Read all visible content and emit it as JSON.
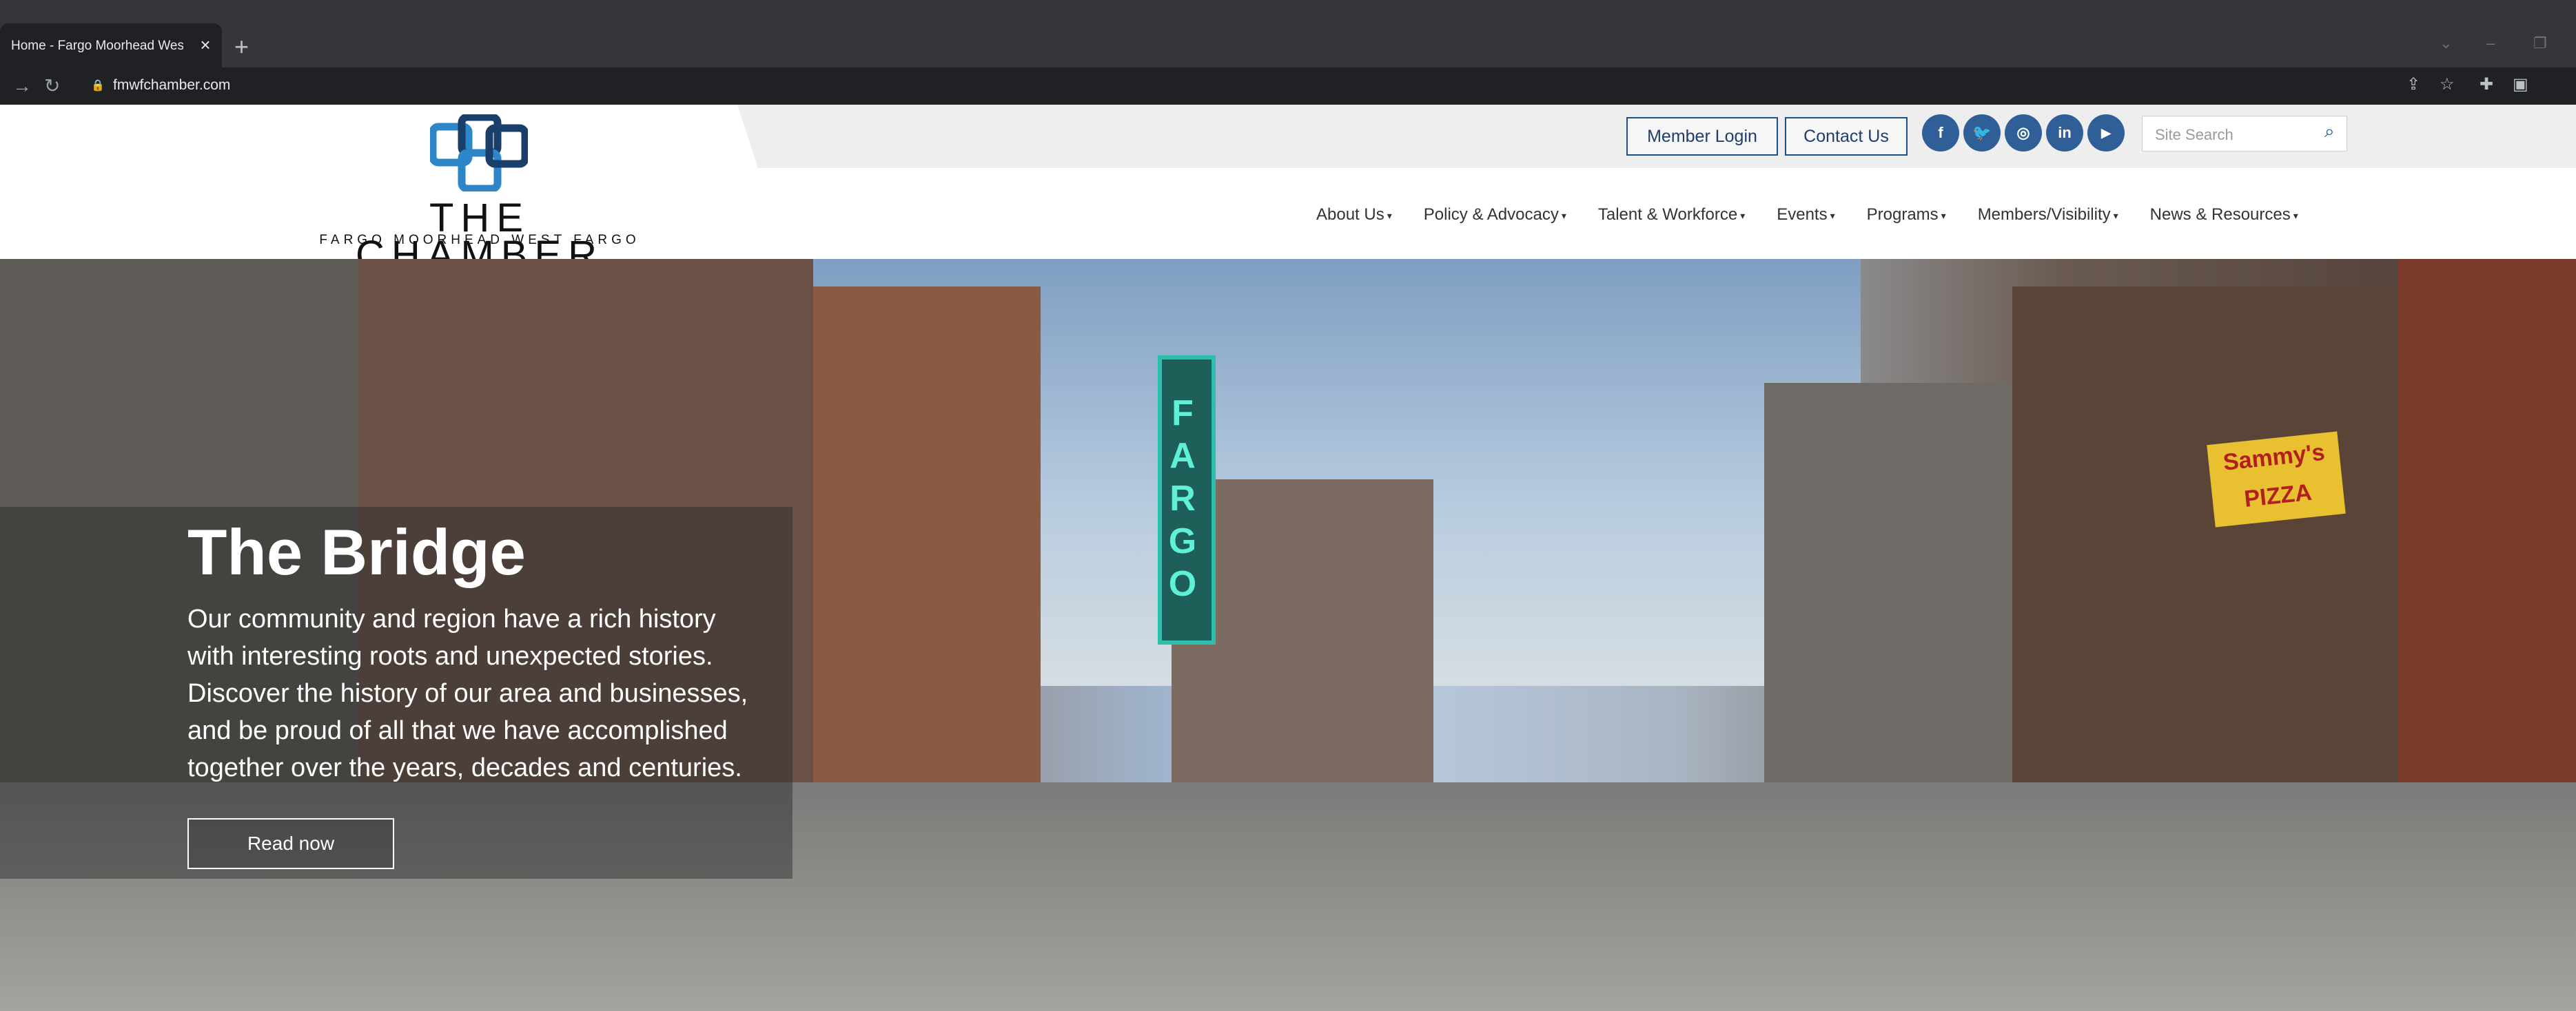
{
  "browser": {
    "tab_title": "Home - Fargo Moorhead West F",
    "tab_close": "×",
    "new_tab": "+",
    "url": "fmwfchamber.com"
  },
  "logo": {
    "title": "THE CHAMBER",
    "subtitle": "FARGO   MOORHEAD   WEST FARGO"
  },
  "utility": {
    "member_login": "Member Login",
    "contact_us": "Contact Us",
    "search_placeholder": "Site Search",
    "social": [
      "facebook",
      "twitter",
      "instagram",
      "linkedin",
      "youtube"
    ]
  },
  "nav": {
    "items": [
      "About Us",
      "Policy & Advocacy",
      "Talent & Workforce",
      "Events",
      "Programs",
      "Members/Visibility",
      "News & Resources"
    ]
  },
  "hero": {
    "title": "The Bridge",
    "text": "Our community and region have a rich history with interesting roots and unexpected stories. Discover the history of our area and businesses, and be proud of all that we have accomplished together over the years, decades and centuries.",
    "button": "Read now",
    "signs": {
      "fargo": "FARGO",
      "sammys": "Sammy's PIZZA"
    }
  },
  "colors": {
    "brand_blue": "#1e4f86",
    "social_blue": "#2f5f96",
    "chrome_dark": "#202124"
  }
}
